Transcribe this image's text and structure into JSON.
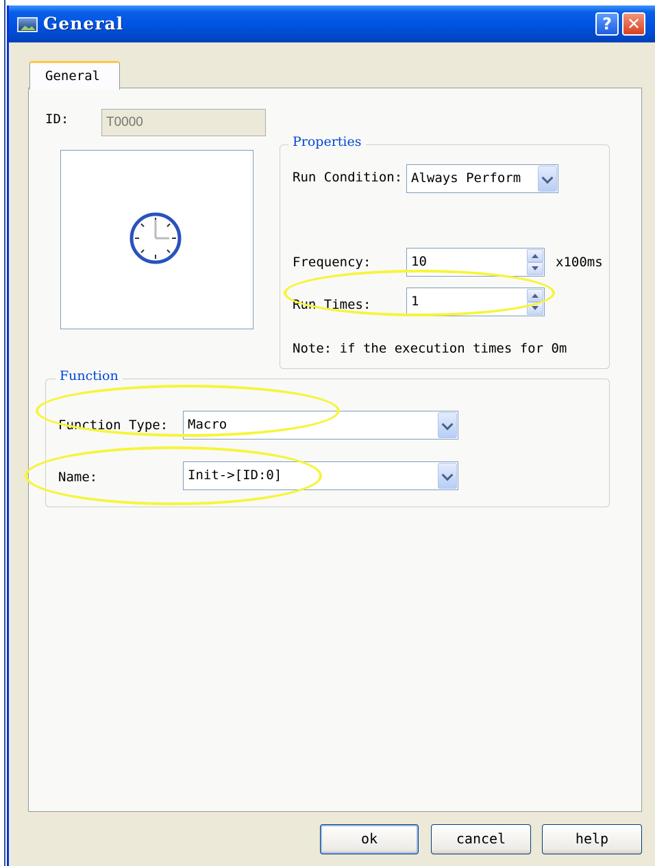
{
  "window": {
    "title": "General",
    "help_glyph": "?",
    "close_glyph": "✕"
  },
  "tabs": [
    {
      "label": "General",
      "selected": true
    }
  ],
  "id_field": {
    "label": "ID:",
    "value": "T0000",
    "enabled": false
  },
  "preview": {
    "icon": "clock-icon"
  },
  "properties": {
    "title": "Properties",
    "run_condition": {
      "label": "Run Condition:",
      "value": "Always Perform"
    },
    "frequency": {
      "label": "Frequency:",
      "value": "10",
      "unit": "x100ms"
    },
    "run_times": {
      "label": "Run Times:",
      "value": "1"
    },
    "note": "Note: if the execution times for 0m"
  },
  "function": {
    "title": "Function",
    "function_type": {
      "label": "Function Type:",
      "value": "Macro"
    },
    "name": {
      "label": "Name:",
      "value": "Init->[ID:0]"
    }
  },
  "buttons": {
    "ok": "ok",
    "cancel": "cancel",
    "help": "help"
  },
  "colors": {
    "titlebar": "#0054e3",
    "dialog_bg": "#ece9d8",
    "group_title": "#0046d5",
    "highlight": "#f5f53a",
    "clock": "#2a52be"
  }
}
